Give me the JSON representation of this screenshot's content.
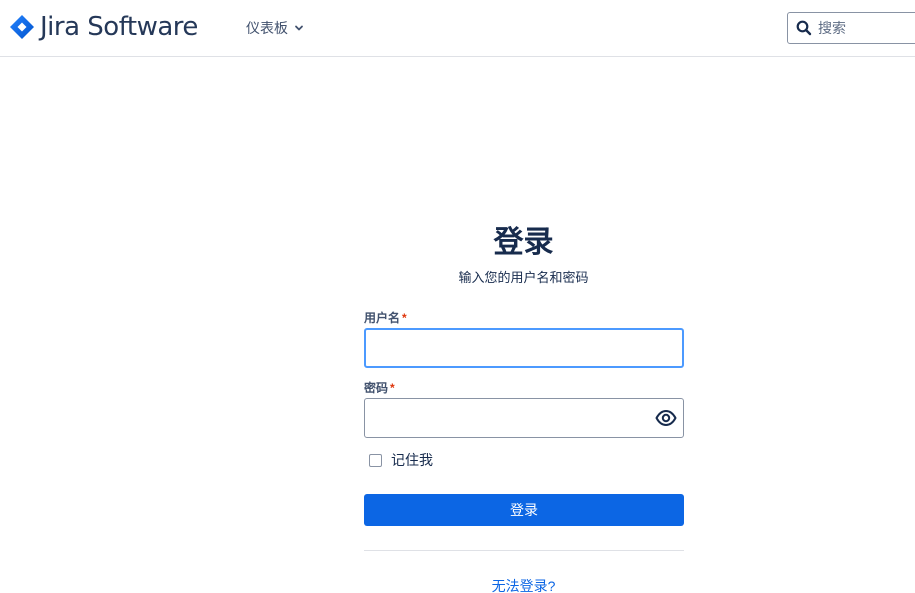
{
  "header": {
    "brand": "Jira Software",
    "nav_dashboards": "仪表板",
    "search_placeholder": "搜索"
  },
  "login": {
    "title": "登录",
    "subtitle": "输入您的用户名和密码",
    "username_label": "用户名",
    "username_value": "",
    "password_label": "密码",
    "password_value": "",
    "required_mark": "*",
    "remember_me": "记住我",
    "remember_checked": false,
    "submit": "登录",
    "cant_login": "无法登录?"
  },
  "colors": {
    "brand_blue": "#2684ff",
    "primary_button": "#0c66e4",
    "focus_border": "#4c9aff",
    "text": "#172b4d"
  },
  "icons": [
    "jira-logo-icon",
    "chevron-down-icon",
    "search-icon",
    "eye-icon"
  ]
}
